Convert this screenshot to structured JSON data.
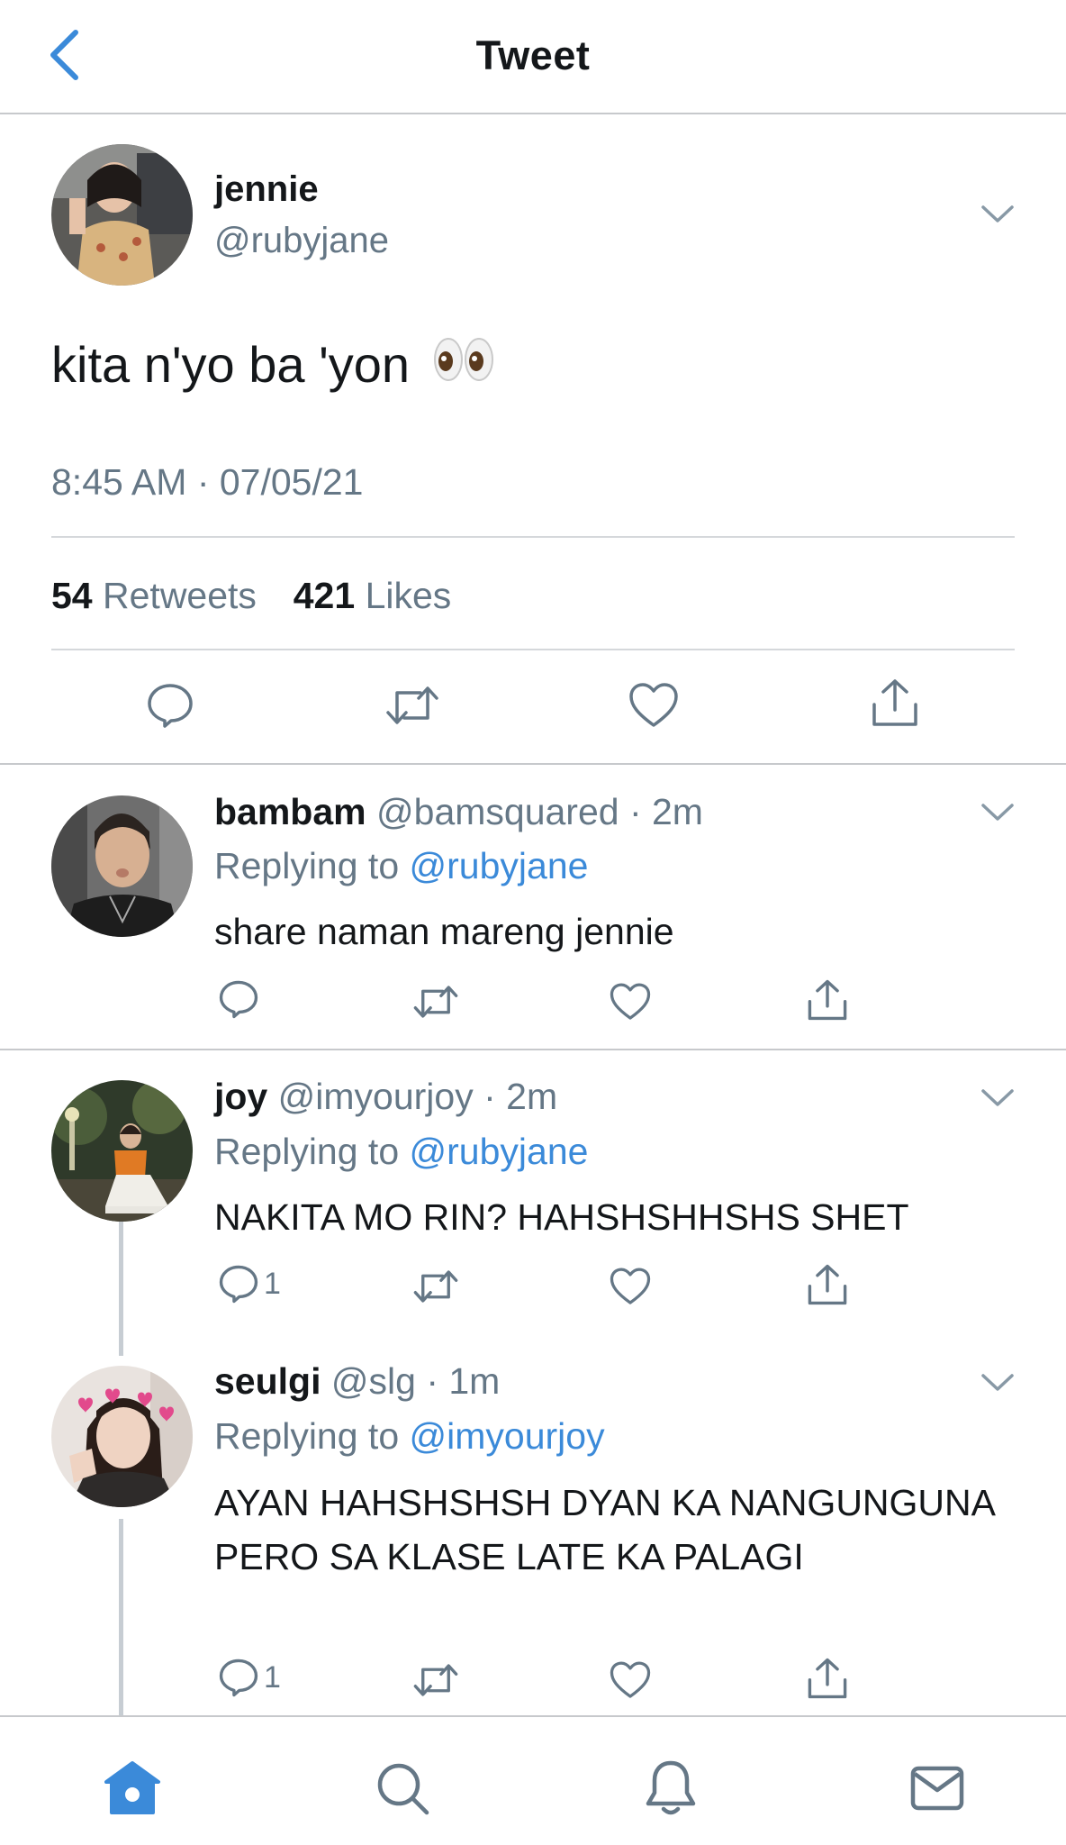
{
  "header": {
    "title": "Tweet"
  },
  "tweet": {
    "name": "jennie",
    "handle": "@rubyjane",
    "text": "kita n'yo ba 'yon",
    "emoji": "eyes",
    "timestamp": "8:45 AM · 07/05/21",
    "retweets_count": "54",
    "retweets_label": "Retweets",
    "likes_count": "421",
    "likes_label": "Likes"
  },
  "replies": [
    {
      "name": "bambam",
      "handle": "@bamsquared",
      "time": "2m",
      "replying_label": "Replying to",
      "replying_to": "@rubyjane",
      "text": "share naman mareng jennie",
      "reply_count": ""
    },
    {
      "name": "joy",
      "handle": "@imyourjoy",
      "time": "2m",
      "replying_label": "Replying to",
      "replying_to": "@rubyjane",
      "text": "NAKITA MO RIN? HAHSHSHHSHS SHET",
      "reply_count": "1"
    },
    {
      "name": "seulgi",
      "handle": "@slg",
      "time": "1m",
      "replying_label": "Replying to",
      "replying_to": "@imyourjoy",
      "text": "AYAN HAHSHSHSH DYAN KA NANGUNGUNA PERO SA KLASE LATE KA PALAGI",
      "reply_count": "1"
    }
  ],
  "tabbar": [
    "home-icon",
    "search-icon",
    "notifications-icon",
    "messages-icon"
  ],
  "colors": {
    "accent": "#3b8ad9",
    "muted": "#657786",
    "divider": "#d5d8db"
  }
}
